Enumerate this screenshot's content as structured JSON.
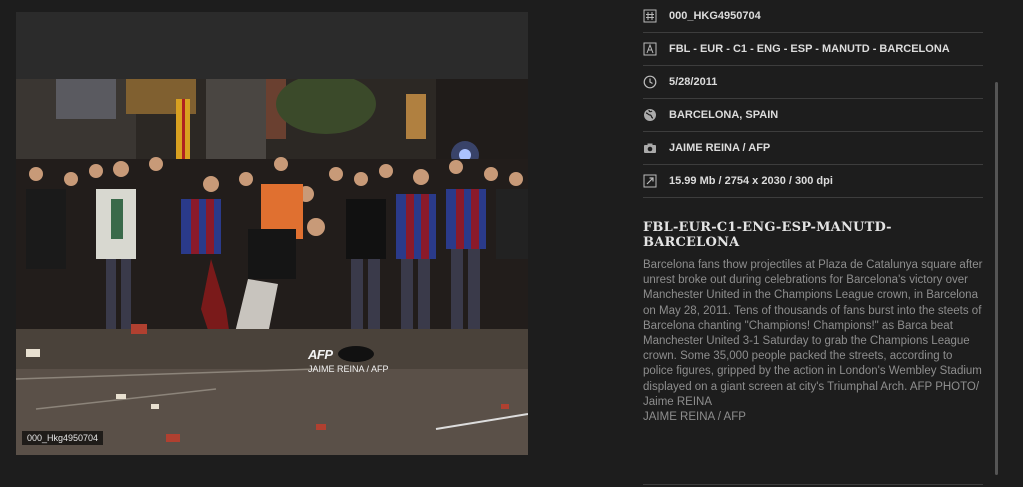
{
  "viewer": {
    "photo_id_badge": "000_Hkg4950704",
    "watermark_logo": "AFP",
    "watermark_credit": "JAIME REINA / AFP"
  },
  "meta": {
    "rows": [
      {
        "icon": "hash-icon",
        "text": "000_HKG4950704"
      },
      {
        "icon": "text-a-icon",
        "text": "FBL - EUR - C1 - ENG - ESP - MANUTD - BARCELONA"
      },
      {
        "icon": "clock-icon",
        "text": "5/28/2011"
      },
      {
        "icon": "globe-icon",
        "text": "BARCELONA, SPAIN"
      },
      {
        "icon": "camera-icon",
        "text": "JAIME REINA / AFP"
      },
      {
        "icon": "resize-icon",
        "text": "15.99 Mb / 2754 x 2030 / 300 dpi"
      }
    ],
    "title": "FBL-EUR-C1-ENG-ESP-MANUTD-BARCELONA",
    "caption": "Barcelona fans thow projectiles at Plaza de Catalunya square after unrest broke out during celebrations for Barcelona's victory over Manchester United in the Champions League crown, in Barcelona on May 28, 2011. Tens of thousands of fans burst into the steets of Barcelona chanting \"Champions! Champions!\" as Barca beat Manchester United 3-1 Saturday to grab the Champions League crown. Some 35,000 people packed the streets, according to police figures, gripped by the action in London's Wembley Stadium displayed on a giant screen at city's Triumphal Arch. AFP PHOTO/ Jaime REINA",
    "credit_line": "JAIME REINA / AFP"
  },
  "colors": {
    "background": "#1d1d1d",
    "viewer_bg": "#2b2b2b",
    "row_divider": "#3d3d3d",
    "caption_text": "#8e8e8e"
  }
}
